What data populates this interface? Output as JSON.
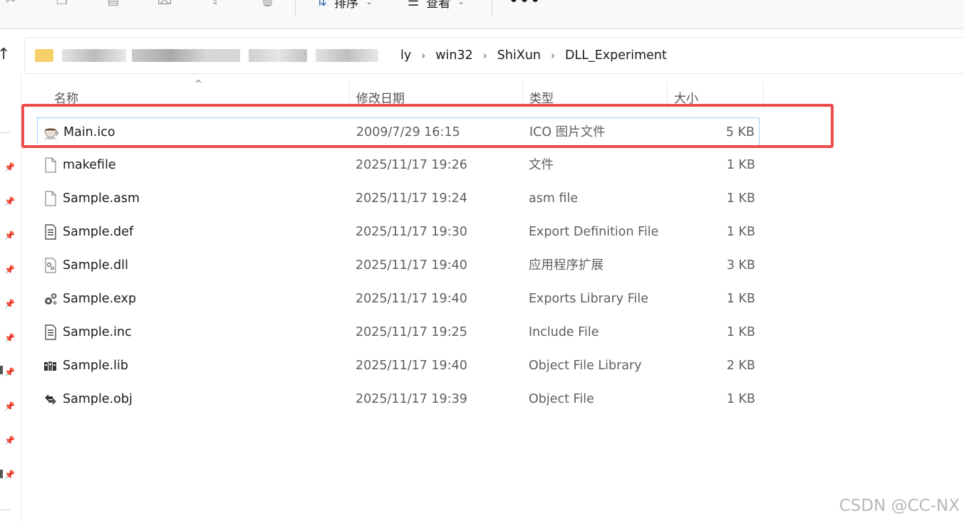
{
  "toolbar": {
    "sort_label": "排序",
    "view_label": "查看",
    "more_label": "•••"
  },
  "address": {
    "visible_partial": "ly",
    "crumbs": [
      "win32",
      "ShiXun",
      "DLL_Experiment"
    ]
  },
  "columns": {
    "name": "名称",
    "date": "修改日期",
    "type": "类型",
    "size": "大小"
  },
  "files": [
    {
      "name": "Main.ico",
      "date": "2009/7/29 16:15",
      "type": "ICO 图片文件",
      "size": "5 KB",
      "icon": "coffee-cup-icon"
    },
    {
      "name": "makefile",
      "date": "2025/11/17 19:26",
      "type": "文件",
      "size": "1 KB",
      "icon": "blank-file-icon"
    },
    {
      "name": "Sample.asm",
      "date": "2025/11/17 19:24",
      "type": "asm file",
      "size": "1 KB",
      "icon": "blank-file-icon"
    },
    {
      "name": "Sample.def",
      "date": "2025/11/17 19:30",
      "type": "Export Definition File",
      "size": "1 KB",
      "icon": "text-file-icon"
    },
    {
      "name": "Sample.dll",
      "date": "2025/11/17 19:40",
      "type": "应用程序扩展",
      "size": "3 KB",
      "icon": "dll-file-icon"
    },
    {
      "name": "Sample.exp",
      "date": "2025/11/17 19:40",
      "type": "Exports Library File",
      "size": "1 KB",
      "icon": "gears-icon"
    },
    {
      "name": "Sample.inc",
      "date": "2025/11/17 19:25",
      "type": "Include File",
      "size": "1 KB",
      "icon": "text-file-icon"
    },
    {
      "name": "Sample.lib",
      "date": "2025/11/17 19:40",
      "type": "Object File Library",
      "size": "2 KB",
      "icon": "library-icon"
    },
    {
      "name": "Sample.obj",
      "date": "2025/11/17 19:39",
      "type": "Object File",
      "size": "1 KB",
      "icon": "object-file-icon"
    }
  ],
  "watermark": "CSDN @CC-NX",
  "colors": {
    "annotation": "#ef4c4c",
    "selection_border": "#99d1ff"
  }
}
